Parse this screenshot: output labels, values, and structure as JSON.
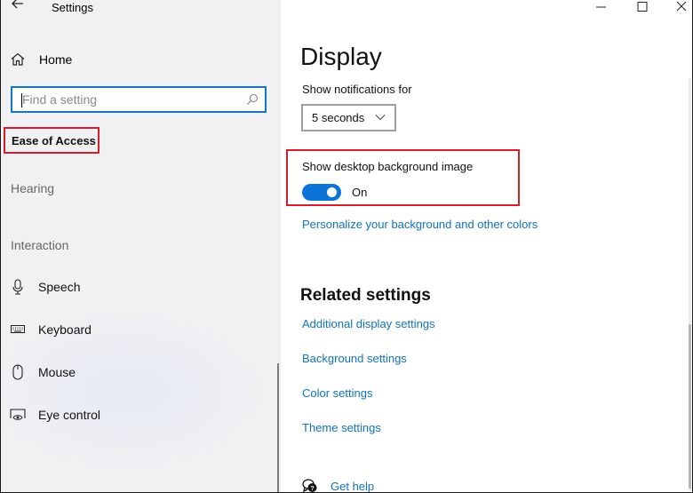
{
  "window": {
    "app_title": "Settings",
    "controls": {
      "minimize": "minimize",
      "maximize": "maximize",
      "close": "close"
    }
  },
  "sidebar": {
    "home_label": "Home",
    "search": {
      "placeholder": "Find a setting",
      "value": ""
    },
    "category_title": "Ease of Access",
    "sections": [
      {
        "label": "Hearing",
        "items": []
      },
      {
        "label": "Interaction",
        "items": [
          {
            "label": "Speech",
            "icon": "microphone-icon"
          },
          {
            "label": "Keyboard",
            "icon": "keyboard-icon"
          },
          {
            "label": "Mouse",
            "icon": "mouse-icon"
          },
          {
            "label": "Eye control",
            "icon": "eye-control-icon"
          }
        ]
      }
    ]
  },
  "main": {
    "page_title": "Display",
    "notifications": {
      "label": "Show notifications for",
      "selected": "5 seconds"
    },
    "background_image": {
      "label": "Show desktop background image",
      "state": "On",
      "enabled": true
    },
    "personalize_link": "Personalize your background and other colors",
    "related": {
      "title": "Related settings",
      "links": [
        "Additional display settings",
        "Background settings",
        "Color settings",
        "Theme settings"
      ]
    },
    "help_link": "Get help"
  },
  "colors": {
    "accent": "#0c74d6",
    "link": "#1272bf",
    "highlight_box": "#d41e2c",
    "search_border": "#0a78d4"
  }
}
